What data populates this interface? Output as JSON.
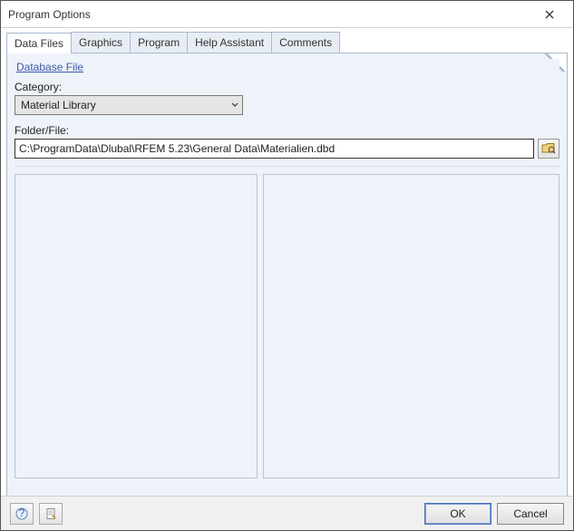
{
  "window": {
    "title": "Program Options"
  },
  "tabs": {
    "items": [
      {
        "label": "Data Files"
      },
      {
        "label": "Graphics"
      },
      {
        "label": "Program"
      },
      {
        "label": "Help Assistant"
      },
      {
        "label": "Comments"
      }
    ],
    "activeIndex": 0
  },
  "groupTitle": "Database File",
  "category": {
    "label": "Category:",
    "value": "Material Library"
  },
  "folder": {
    "label": "Folder/File:",
    "value": "C:\\ProgramData\\Dlubal\\RFEM 5.23\\General Data\\Materialien.dbd"
  },
  "buttons": {
    "ok": "OK",
    "cancel": "Cancel"
  }
}
